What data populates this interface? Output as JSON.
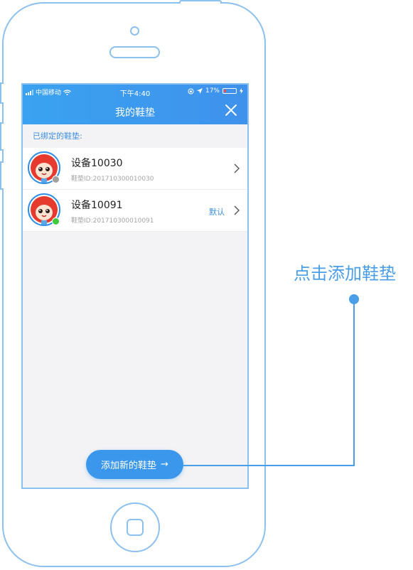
{
  "status_bar": {
    "carrier": "中国移动",
    "time": "下午4:40",
    "battery_percent": "17%"
  },
  "header": {
    "title": "我的鞋垫",
    "close_icon": "close-icon"
  },
  "section_title": "已绑定的鞋垫:",
  "devices": [
    {
      "name": "设备10030",
      "id_label": "鞋垫ID:201710300010030",
      "status": "offline",
      "status_color": "#a0a0a0",
      "is_default": false
    },
    {
      "name": "设备10091",
      "id_label": "鞋垫ID:201710300010091",
      "status": "online",
      "status_color": "#3ccb3c",
      "is_default": true,
      "default_label": "默认"
    }
  ],
  "add_button": {
    "label": "添加新的鞋垫",
    "arrow": "→"
  },
  "callout": {
    "text": "点击添加鞋垫"
  },
  "colors": {
    "accent": "#3b97ec",
    "frame": "#8cc0ee",
    "battery_low": "#ff4a4a"
  }
}
